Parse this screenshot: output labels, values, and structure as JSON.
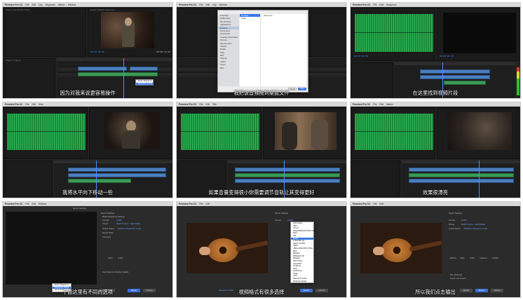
{
  "menu": {
    "app": "Premiere Pro CC",
    "items": [
      "File",
      "Edit",
      "Clip",
      "Sequence",
      "Marker",
      "Title",
      "Window",
      "Help"
    ]
  },
  "panels": {
    "program": "Program: Multicam Sequence 1",
    "source": "Source: Look Def Wav Thelp 1",
    "project": "Project: 1.5 Merge",
    "timeline": "Multicam Sequence 1",
    "export_title": "Export Settings"
  },
  "dialog": {
    "sidebar": [
      "Favorites",
      "All My Files",
      "iCloud Drive",
      "Applications",
      "Desktop",
      "Documents",
      "Downloads",
      "Creative Cloud Files",
      "Devices",
      "Remote Disc",
      "Shared",
      "Media",
      "Tags",
      "Red",
      "Orange",
      "Yellow",
      "Green",
      "Blue"
    ],
    "files": [
      "Footage",
      "Audio",
      "Sequence"
    ],
    "cancel": "Cancel",
    "open": "Open"
  },
  "export": {
    "labels": [
      "Export Settings",
      "Match Sequence Settings",
      "Format:",
      "Preset:",
      "Comments:",
      "Output Name:",
      "Export Video",
      "Export Audio",
      "Summary",
      "Effects",
      "Video",
      "Audio",
      "Captions",
      "Publish",
      "Use Maximum Render Quality",
      "Use Previews",
      "Import into project",
      "Metadata...",
      "Queue",
      "Export",
      "Cancel"
    ],
    "format_value": "H.264",
    "preset_value": "Match Source - High bitrate",
    "output_value": "Multicam Sequence 1.mp4",
    "source_range": "Sequence In/Out",
    "formats": [
      "AAC Audio",
      "AIFF",
      "AS-10",
      "AS-11",
      "DNxHR/DNxHD MXF OP1a",
      "DPX",
      "GIF",
      "H.264",
      "H.264 Blu-ray",
      "HEVC (H.265)",
      "JPEG",
      "JPEG 2000 MXF OP1a",
      "MP3",
      "MPEG2",
      "MPEG2-DVD",
      "MPEG4",
      "MXF OP1a",
      "OpenEXR",
      "P2 Movie",
      "PNG",
      "QuickTime",
      "Targa",
      "TIFF",
      "Waveform Audio",
      "Windows Media"
    ],
    "small_menu": [
      "Entire Sequence",
      "Sequence In/Out",
      "Work Area",
      "Custom"
    ]
  },
  "timecodes": {
    "a": "00:00:00:00",
    "b": "00:00:04:10",
    "c": "00:00:13:22"
  },
  "subtitles": [
    "因为对我来说更容易操作",
    "我把该音频拖到桌面文件",
    "在这里找到视频片段",
    "我将水平向下移动一些",
    "如果音量变得很小你需要调节音轨让其变得更好",
    "效果很漂亮",
    "下面这里有不同的选项",
    "视频格式有很多选择",
    "所以我们点击输出"
  ],
  "colors": {
    "accent": "#3b8cff",
    "wave": "#2bb552",
    "clip_video": "#4b7fbf",
    "export_button": "#3a6fd8"
  }
}
